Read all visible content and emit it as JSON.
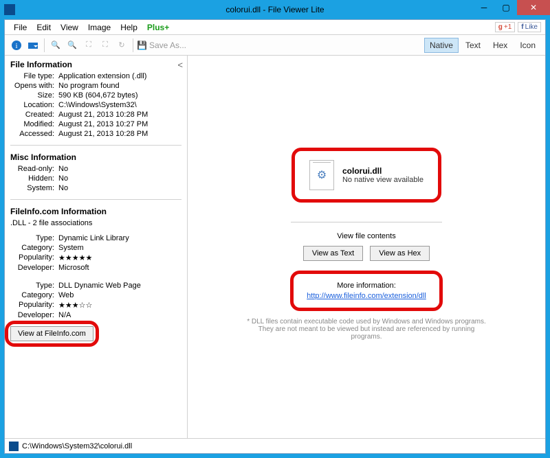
{
  "window": {
    "title": "colorui.dll - File Viewer Lite"
  },
  "menu": {
    "file": "File",
    "edit": "Edit",
    "view": "View",
    "image": "Image",
    "help": "Help",
    "plus": "Plus+"
  },
  "social": {
    "g1": "+1",
    "like": "Like"
  },
  "toolbar": {
    "save_as": "Save As...",
    "native": "Native",
    "text": "Text",
    "hex": "Hex",
    "icon": "Icon"
  },
  "sidebar": {
    "file_info": {
      "title": "File Information",
      "rows": [
        {
          "k": "File type:",
          "v": "Application extension (.dll)"
        },
        {
          "k": "Opens with:",
          "v": "No program found"
        },
        {
          "k": "Size:",
          "v": "590 KB (604,672 bytes)"
        },
        {
          "k": "Location:",
          "v": "C:\\Windows\\System32\\"
        },
        {
          "k": "Created:",
          "v": "August 21, 2013 10:28 PM"
        },
        {
          "k": "Modified:",
          "v": "August 21, 2013 10:27 PM"
        },
        {
          "k": "Accessed:",
          "v": "August 21, 2013 10:28 PM"
        }
      ]
    },
    "misc_info": {
      "title": "Misc Information",
      "rows": [
        {
          "k": "Read-only:",
          "v": "No"
        },
        {
          "k": "Hidden:",
          "v": "No"
        },
        {
          "k": "System:",
          "v": "No"
        }
      ]
    },
    "fileinfo": {
      "title": "FileInfo.com Information",
      "assoc": ".DLL - 2 file associations",
      "group1": [
        {
          "k": "Type:",
          "v": "Dynamic Link Library"
        },
        {
          "k": "Category:",
          "v": "System"
        },
        {
          "k": "Popularity:",
          "v": "★★★★★"
        },
        {
          "k": "Developer:",
          "v": "Microsoft"
        }
      ],
      "group2": [
        {
          "k": "Type:",
          "v": "DLL Dynamic Web Page"
        },
        {
          "k": "Category:",
          "v": "Web"
        },
        {
          "k": "Popularity:",
          "v": "★★★☆☆"
        },
        {
          "k": "Developer:",
          "v": "N/A"
        }
      ],
      "button": "View at FileInfo.com"
    }
  },
  "main": {
    "filename": "colorui.dll",
    "no_view": "No native view available",
    "view_contents": "View file contents",
    "view_as_text": "View as Text",
    "view_as_hex": "View as Hex",
    "more_info": "More information:",
    "more_info_url": "http://www.fileinfo.com/extension/dll",
    "footnote": "* DLL files contain executable code used by Windows and Windows programs.  They are not meant to be viewed but instead are referenced by running programs."
  },
  "statusbar": {
    "path": "C:\\Windows\\System32\\colorui.dll"
  }
}
